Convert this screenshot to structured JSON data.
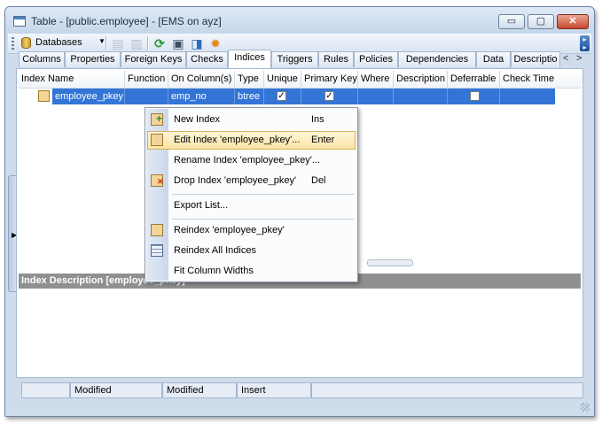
{
  "window": {
    "title": "Table - [public.employee] - [EMS on ayz]",
    "buttons": {
      "minimize": "▭",
      "maximize": "▢",
      "close": "✕"
    }
  },
  "toolbar": {
    "databases_label": "Databases",
    "icons": [
      "back-icon",
      "forward-icon",
      "refresh-icon",
      "print-icon",
      "export-icon",
      "settings-icon"
    ]
  },
  "tabs": [
    {
      "label": "Columns",
      "active": false
    },
    {
      "label": "Properties",
      "active": false
    },
    {
      "label": "Foreign Keys",
      "active": false
    },
    {
      "label": "Checks",
      "active": false
    },
    {
      "label": "Indices",
      "active": true
    },
    {
      "label": "Triggers",
      "active": false
    },
    {
      "label": "Rules",
      "active": false
    },
    {
      "label": "Policies",
      "active": false
    },
    {
      "label": "Dependencies",
      "active": false
    },
    {
      "label": "Data",
      "active": false
    },
    {
      "label": "Descriptio",
      "active": false
    }
  ],
  "grid": {
    "columns": [
      "Index Name",
      "Function",
      "On Column(s)",
      "Type",
      "Unique",
      "Primary Key",
      "Where",
      "Description",
      "Deferrable",
      "Check Time"
    ],
    "rows": [
      {
        "index_name": "employee_pkey",
        "function": "",
        "on_columns": "emp_no",
        "type": "btree",
        "unique": true,
        "primary_key": true,
        "where": "",
        "description": "",
        "deferrable": false,
        "check_time": ""
      }
    ]
  },
  "description_panel": {
    "title": "Index Description [employee_pkey]"
  },
  "context_menu": {
    "items": [
      {
        "label": "New Index",
        "shortcut": "Ins",
        "icon": "new-index-icon",
        "highlighted": false
      },
      {
        "label": "Edit Index 'employee_pkey'...",
        "shortcut": "Enter",
        "icon": "edit-index-icon",
        "highlighted": true
      },
      {
        "label": "Rename Index 'employee_pkey'...",
        "shortcut": "",
        "icon": "",
        "highlighted": false
      },
      {
        "label": "Drop Index 'employee_pkey'",
        "shortcut": "Del",
        "icon": "drop-index-icon",
        "highlighted": false
      },
      {
        "label": "Export List...",
        "shortcut": "",
        "icon": "",
        "highlighted": false
      },
      {
        "label": "Reindex 'employee_pkey'",
        "shortcut": "",
        "icon": "reindex-icon",
        "highlighted": false
      },
      {
        "label": "Reindex All Indices",
        "shortcut": "",
        "icon": "reindex-all-icon",
        "highlighted": false
      },
      {
        "label": "Fit Column Widths",
        "shortcut": "",
        "icon": "",
        "highlighted": false
      }
    ]
  },
  "statusbar": [
    "",
    "Modified",
    "Modified",
    "Insert",
    ""
  ]
}
